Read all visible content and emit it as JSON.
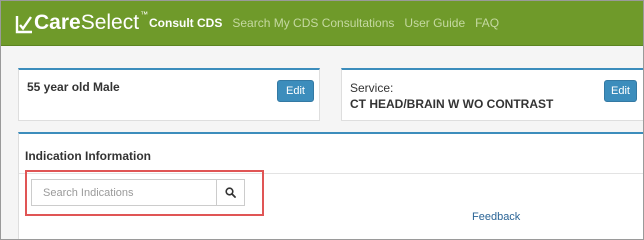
{
  "brand": {
    "name_bold": "Care",
    "name_light": "Select",
    "trademark": "™"
  },
  "nav": {
    "items": [
      {
        "label": "Consult CDS",
        "active": true
      },
      {
        "label": "Search My CDS Consultations",
        "active": false
      },
      {
        "label": "User Guide",
        "active": false
      },
      {
        "label": "FAQ",
        "active": false
      }
    ]
  },
  "patient": {
    "summary": "55 year old Male",
    "edit_label": "Edit"
  },
  "service": {
    "label": "Service:",
    "value": "CT HEAD/BRAIN W WO CONTRAST",
    "edit_label": "Edit"
  },
  "indication": {
    "title": "Indication Information",
    "search_placeholder": "Search Indications",
    "feedback_label": "Feedback"
  },
  "colors": {
    "header_green": "#6f9a2a",
    "accent_blue": "#3c8dbc",
    "highlight_red": "#e05555",
    "link_blue": "#2a6496"
  },
  "icons": {
    "logo": "checkmark-logo-icon",
    "search": "search-icon"
  }
}
